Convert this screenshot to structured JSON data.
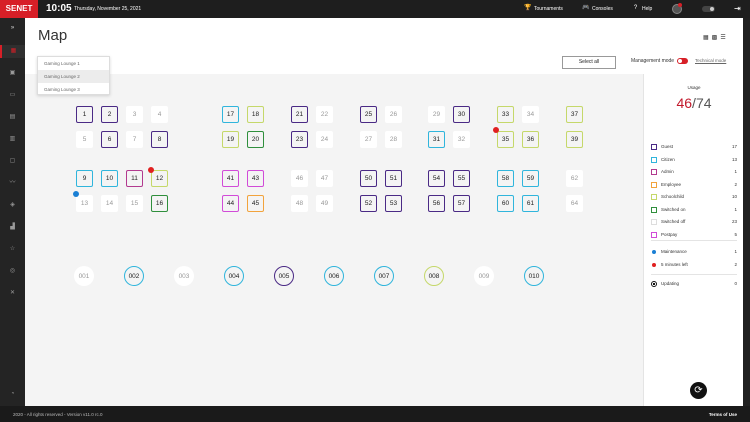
{
  "topbar": {
    "logo": "SENET",
    "time": "10:05",
    "date": "Thursday, November 25, 2021",
    "buttons": [
      {
        "label": "Tournaments",
        "icon": "trophy-icon"
      },
      {
        "label": "Consoles",
        "icon": "gamepad-icon"
      },
      {
        "label": "Help",
        "icon": "help-icon"
      }
    ]
  },
  "sidebar": {
    "expand_icon": "»",
    "items": [
      "map-icon",
      "calendar-icon",
      "user-card-icon",
      "grid-icon",
      "book-icon",
      "screen-icon",
      "chart-icon",
      "ticket-icon",
      "stats-icon",
      "star-icon",
      "location-icon",
      "tools-icon"
    ],
    "bottom_icon": "gamepad-icon"
  },
  "header": {
    "title": "Map",
    "dropdown": [
      "Gaming Lounge 1",
      "Gaming Lounge 2",
      "Gaming Lounge 3"
    ],
    "dropdown_selected": "Gaming Lounge 2",
    "select_all": "Select all",
    "management_mode": "Management mode",
    "technical_mode": "Technical mode"
  },
  "pcs": [
    {
      "n": "1",
      "s": "guest"
    },
    {
      "n": "2",
      "s": "guest"
    },
    {
      "n": "3",
      "s": "off"
    },
    {
      "n": "4",
      "s": "off"
    },
    {
      "n": "5",
      "s": "off"
    },
    {
      "n": "6",
      "s": "guest"
    },
    {
      "n": "7",
      "s": "off"
    },
    {
      "n": "8",
      "s": "guest"
    },
    {
      "n": "17",
      "s": "citizen"
    },
    {
      "n": "18",
      "s": "school"
    },
    {
      "n": "19",
      "s": "school"
    },
    {
      "n": "20",
      "s": "swon"
    },
    {
      "n": "21",
      "s": "guest"
    },
    {
      "n": "22",
      "s": "off"
    },
    {
      "n": "23",
      "s": "guest"
    },
    {
      "n": "24",
      "s": "off"
    },
    {
      "n": "25",
      "s": "guest"
    },
    {
      "n": "26",
      "s": "off"
    },
    {
      "n": "27",
      "s": "off"
    },
    {
      "n": "28",
      "s": "off"
    },
    {
      "n": "29",
      "s": "off"
    },
    {
      "n": "30",
      "s": "guest"
    },
    {
      "n": "31",
      "s": "citizen"
    },
    {
      "n": "32",
      "s": "off"
    },
    {
      "n": "33",
      "s": "school"
    },
    {
      "n": "34",
      "s": "off"
    },
    {
      "n": "35",
      "s": "school"
    },
    {
      "n": "36",
      "s": "school"
    },
    {
      "n": "37",
      "s": "school"
    },
    {
      "n": "39",
      "s": "school"
    },
    {
      "n": "9",
      "s": "citizen"
    },
    {
      "n": "10",
      "s": "citizen"
    },
    {
      "n": "11",
      "s": "admin"
    },
    {
      "n": "12",
      "s": "school"
    },
    {
      "n": "13",
      "s": "off"
    },
    {
      "n": "14",
      "s": "off"
    },
    {
      "n": "15",
      "s": "off"
    },
    {
      "n": "16",
      "s": "swon"
    },
    {
      "n": "41",
      "s": "postpay"
    },
    {
      "n": "43",
      "s": "postpay"
    },
    {
      "n": "44",
      "s": "postpay"
    },
    {
      "n": "45",
      "s": "employee"
    },
    {
      "n": "46",
      "s": "off"
    },
    {
      "n": "47",
      "s": "off"
    },
    {
      "n": "48",
      "s": "off"
    },
    {
      "n": "49",
      "s": "off"
    },
    {
      "n": "50",
      "s": "guest"
    },
    {
      "n": "51",
      "s": "guest"
    },
    {
      "n": "52",
      "s": "guest"
    },
    {
      "n": "53",
      "s": "guest"
    },
    {
      "n": "54",
      "s": "guest"
    },
    {
      "n": "55",
      "s": "guest"
    },
    {
      "n": "56",
      "s": "guest"
    },
    {
      "n": "57",
      "s": "guest"
    },
    {
      "n": "58",
      "s": "citizen"
    },
    {
      "n": "59",
      "s": "citizen"
    },
    {
      "n": "60",
      "s": "citizen"
    },
    {
      "n": "61",
      "s": "citizen"
    },
    {
      "n": "62",
      "s": "off"
    },
    {
      "n": "64",
      "s": "off"
    }
  ],
  "consoles": [
    {
      "n": "001",
      "s": "off"
    },
    {
      "n": "002",
      "s": "citizen"
    },
    {
      "n": "003",
      "s": "off"
    },
    {
      "n": "004",
      "s": "citizen"
    },
    {
      "n": "005",
      "s": "guest"
    },
    {
      "n": "006",
      "s": "citizen"
    },
    {
      "n": "007",
      "s": "citizen"
    },
    {
      "n": "008",
      "s": "school"
    },
    {
      "n": "009",
      "s": "off"
    },
    {
      "n": "010",
      "s": "citizen"
    }
  ],
  "alerts": [
    {
      "pc": "12",
      "type": "red"
    },
    {
      "pc": "13",
      "type": "blue"
    },
    {
      "pc": "35",
      "type": "red"
    }
  ],
  "panel": {
    "usage_label": "Usage",
    "usage_current": "46",
    "usage_total": "74",
    "statuses": [
      {
        "label": "Guest",
        "count": "17",
        "color": "#4a2a85"
      },
      {
        "label": "Citizen",
        "count": "13",
        "color": "#30b5dc"
      },
      {
        "label": "Admin",
        "count": "1",
        "color": "#b23a8f"
      },
      {
        "label": "Employee",
        "count": "2",
        "color": "#f2a33c"
      },
      {
        "label": "Schoolchild",
        "count": "10",
        "color": "#c5d86a"
      },
      {
        "label": "Switched on",
        "count": "1",
        "color": "#2f8f3c"
      },
      {
        "label": "Switched off",
        "count": "23",
        "color": "#dddddd"
      },
      {
        "label": "Postpay",
        "count": "5",
        "color": "#d14bd8"
      }
    ],
    "indicators": [
      {
        "label": "Maintenance",
        "count": "1",
        "color": "#1a7fd4"
      },
      {
        "label": "5 minutes left",
        "count": "2",
        "color": "#e02020"
      }
    ],
    "updating": {
      "label": "Updating",
      "count": "0"
    }
  },
  "footer": {
    "copyright": "2020 - All rights reserved - Version v11.0 rc.0",
    "terms": "Terms of Use"
  }
}
